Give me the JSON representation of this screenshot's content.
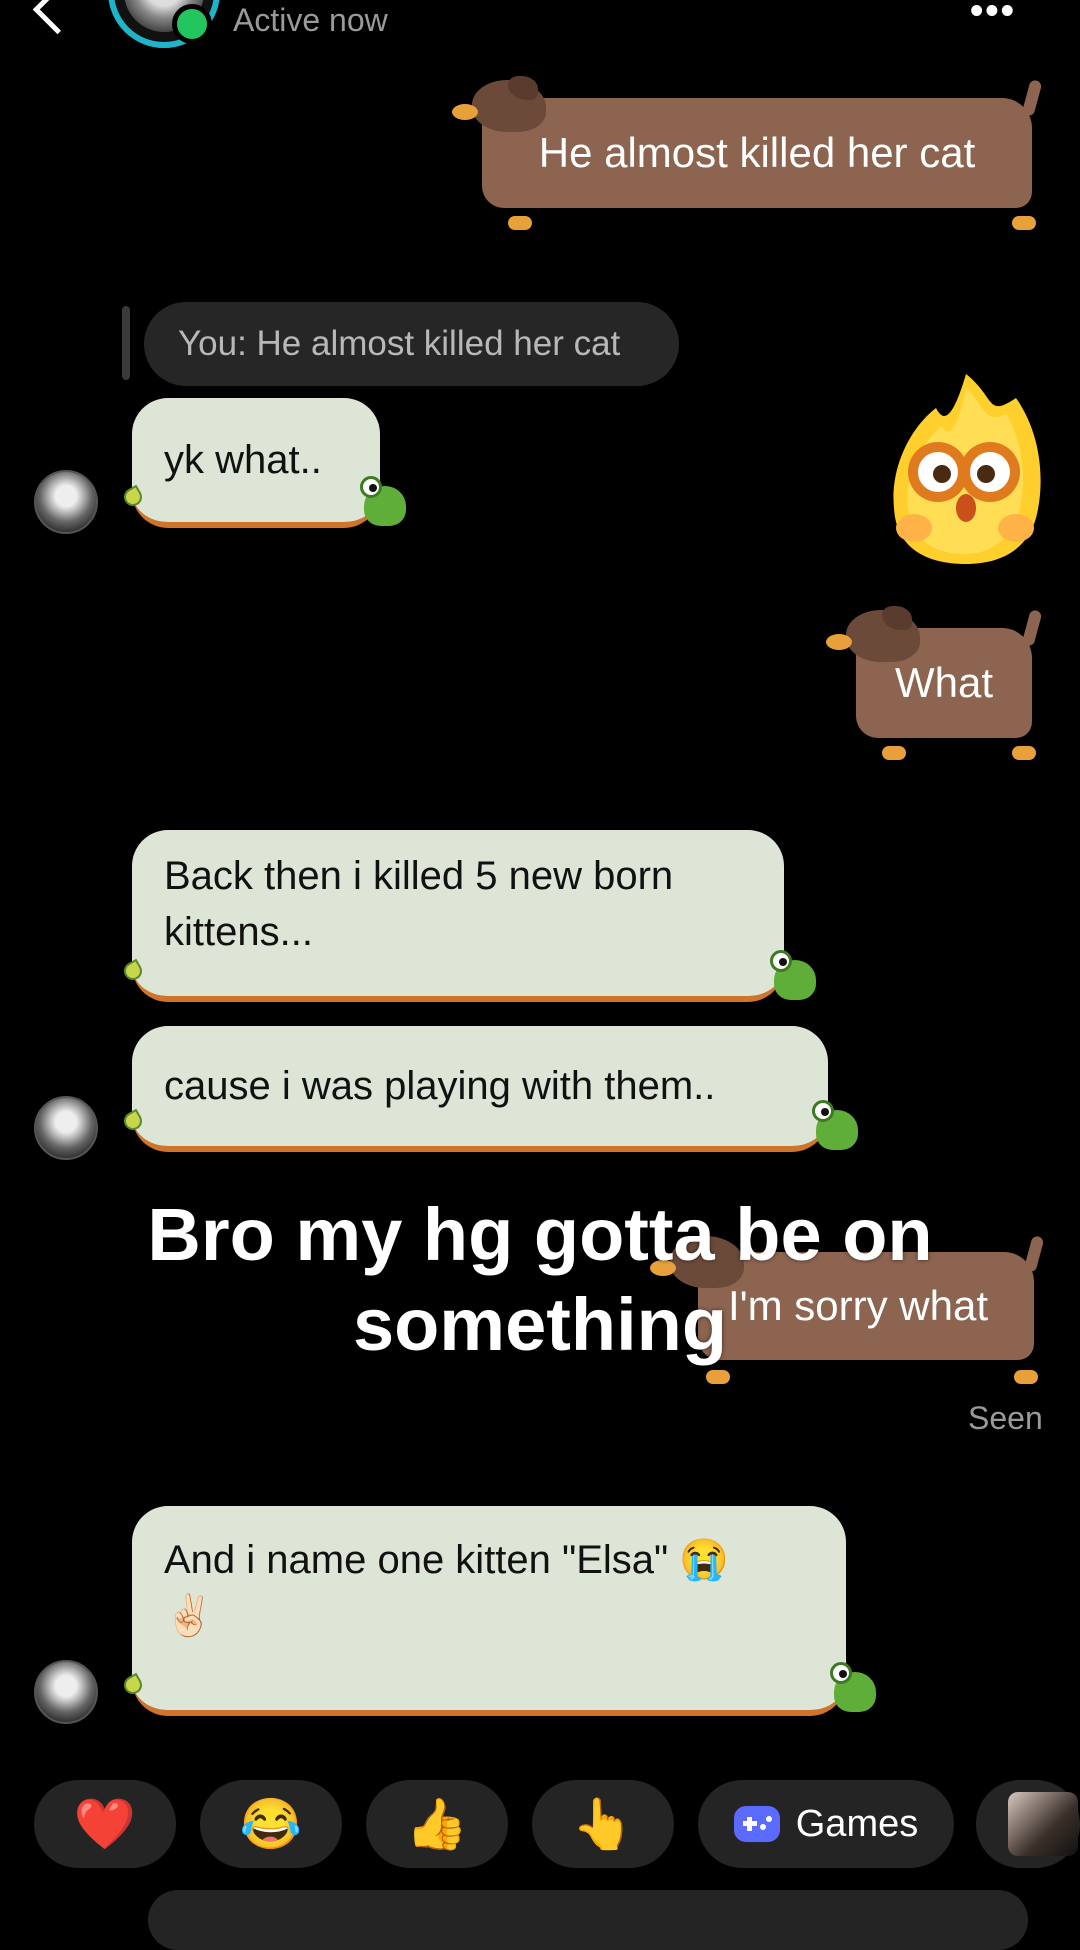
{
  "header": {
    "status": "Active now",
    "more_label": "•••"
  },
  "messages": [
    {
      "from": "me",
      "text": "He almost killed her cat"
    },
    {
      "reply_preview": "You: He almost killed her cat"
    },
    {
      "from": "them",
      "text": "yk what.."
    },
    {
      "from": "me",
      "sticker": "flame-emoji-sticker"
    },
    {
      "from": "me",
      "text": "What"
    },
    {
      "from": "them",
      "text_line1": "Back then i killed 5 new born",
      "text_line2": "kittens..."
    },
    {
      "from": "them",
      "text": "cause i was playing with them.."
    },
    {
      "from": "me",
      "text": "I'm sorry what"
    },
    {
      "from": "them",
      "text_line1": "And i name one kitten \"Elsa\" 😭",
      "text_line2": "✌🏻"
    }
  ],
  "seen_label": "Seen",
  "caption": {
    "line1": "Bro my hg gotta be on",
    "line2": "something"
  },
  "quick_reactions": [
    {
      "emoji": "❤️",
      "name": "heart"
    },
    {
      "emoji": "😂",
      "name": "laughing"
    },
    {
      "emoji": "👍",
      "name": "thumbs-up"
    },
    {
      "emoji": "👆",
      "name": "pointing"
    }
  ],
  "games_label": "Games",
  "colors": {
    "sent_bubble": "#8c6450",
    "received_bubble": "#dce5d6",
    "accent": "#1fb5c9"
  }
}
